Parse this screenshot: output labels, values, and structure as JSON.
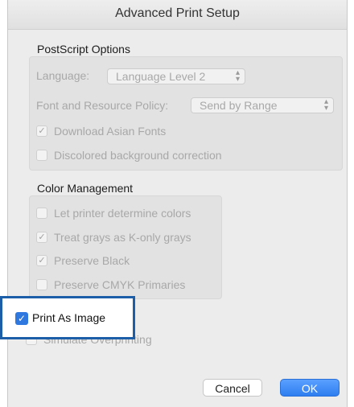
{
  "window": {
    "title": "Advanced Print Setup"
  },
  "postscript": {
    "heading": "PostScript Options",
    "language_label": "Language:",
    "language_value": "Language Level 2",
    "font_policy_label": "Font and Resource Policy:",
    "font_policy_value": "Send by Range",
    "download_asian_fonts": {
      "label": "Download Asian Fonts",
      "checked": true
    },
    "discolored_correction": {
      "label": "Discolored background correction",
      "checked": false
    }
  },
  "color_management": {
    "heading": "Color Management",
    "items": [
      {
        "label": "Let printer determine colors",
        "checked": false
      },
      {
        "label": "Treat grays as K-only grays",
        "checked": true
      },
      {
        "label": "Preserve Black",
        "checked": true
      },
      {
        "label": "Preserve CMYK Primaries",
        "checked": false
      }
    ]
  },
  "print_as_image": {
    "label": "Print As Image",
    "checked": true
  },
  "simulate_overprinting": {
    "label": "Simulate Overprinting",
    "checked": false
  },
  "buttons": {
    "cancel": "Cancel",
    "ok": "OK"
  },
  "colors": {
    "accent": "#2f78e0",
    "highlight_border": "#1c5fa8"
  }
}
